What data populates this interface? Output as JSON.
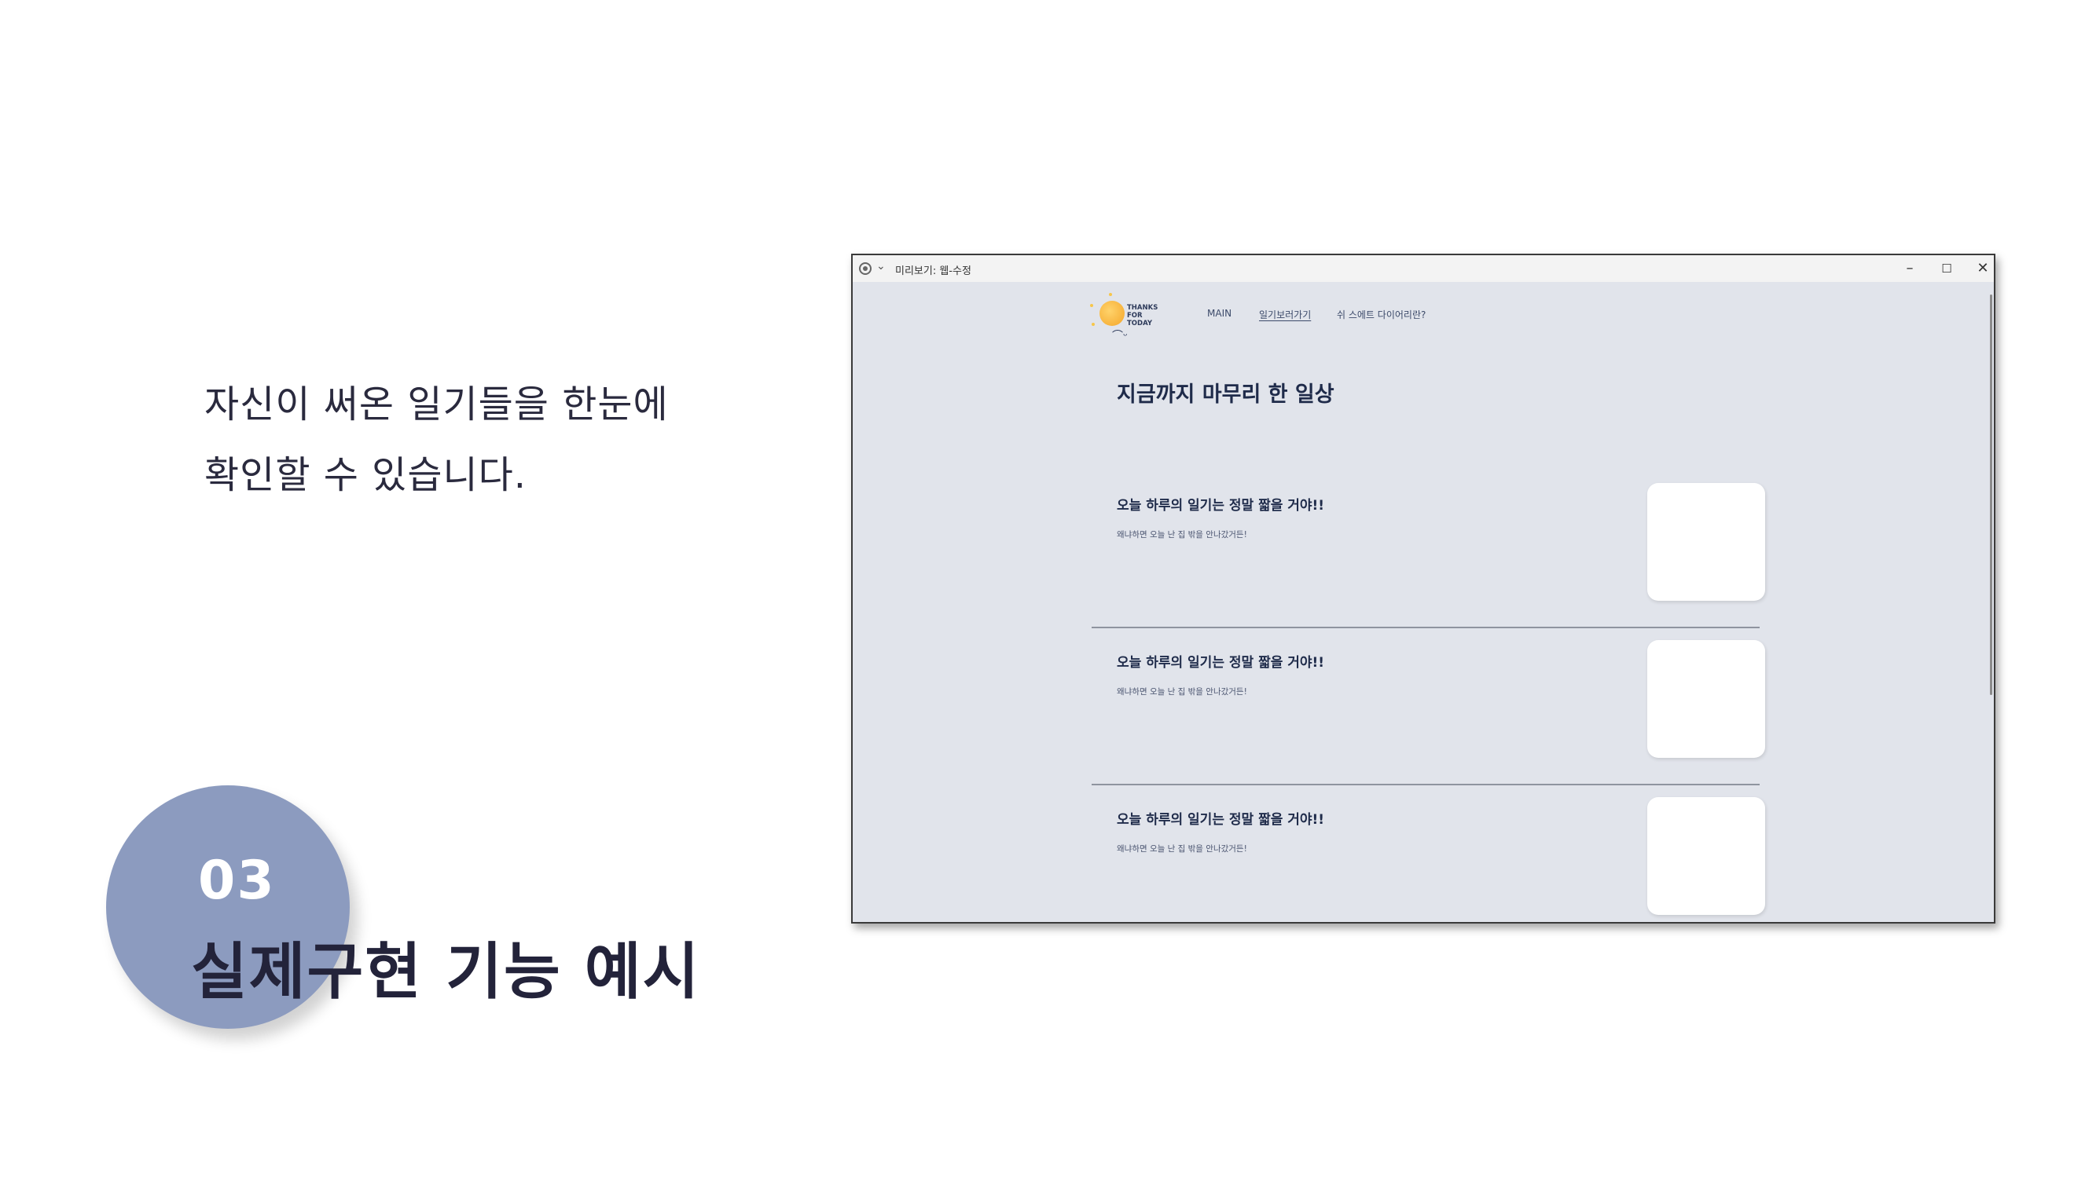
{
  "slide": {
    "description_line1": "자신이 써온 일기들을 한눈에",
    "description_line2": "확인할 수 있습니다.",
    "section_number": "03",
    "section_title": "실제구현 기능 예시",
    "circle_color": "#8c9bbf"
  },
  "window": {
    "title": "미리보기: 웹-수정",
    "controls": {
      "minimize": "–",
      "maximize": "☐",
      "close": "✕"
    }
  },
  "site": {
    "logo_text_line1": "THANKS",
    "logo_text_line2": "FOR",
    "logo_text_line3": "TODAY",
    "nav": {
      "main": "MAIN",
      "diary": "일기보러가기",
      "about": "쉬 스에트 다이어리란?"
    },
    "heading": "지금까지 마무리 한 일상",
    "background_color": "#e1e4eb",
    "entries": [
      {
        "title": "오늘 하루의 일기는 정말 짧을 거야!!",
        "subtitle": "왜냐하면 오늘 난 집 밖을 안나갔거든!"
      },
      {
        "title": "오늘 하루의 일기는 정말 짧을 거야!!",
        "subtitle": "왜냐하면 오늘 난 집 밖을 안나갔거든!"
      },
      {
        "title": "오늘 하루의 일기는 정말 짧을 거야!!",
        "subtitle": "왜냐하면 오늘 난 집 밖을 안나갔거든!"
      }
    ]
  }
}
